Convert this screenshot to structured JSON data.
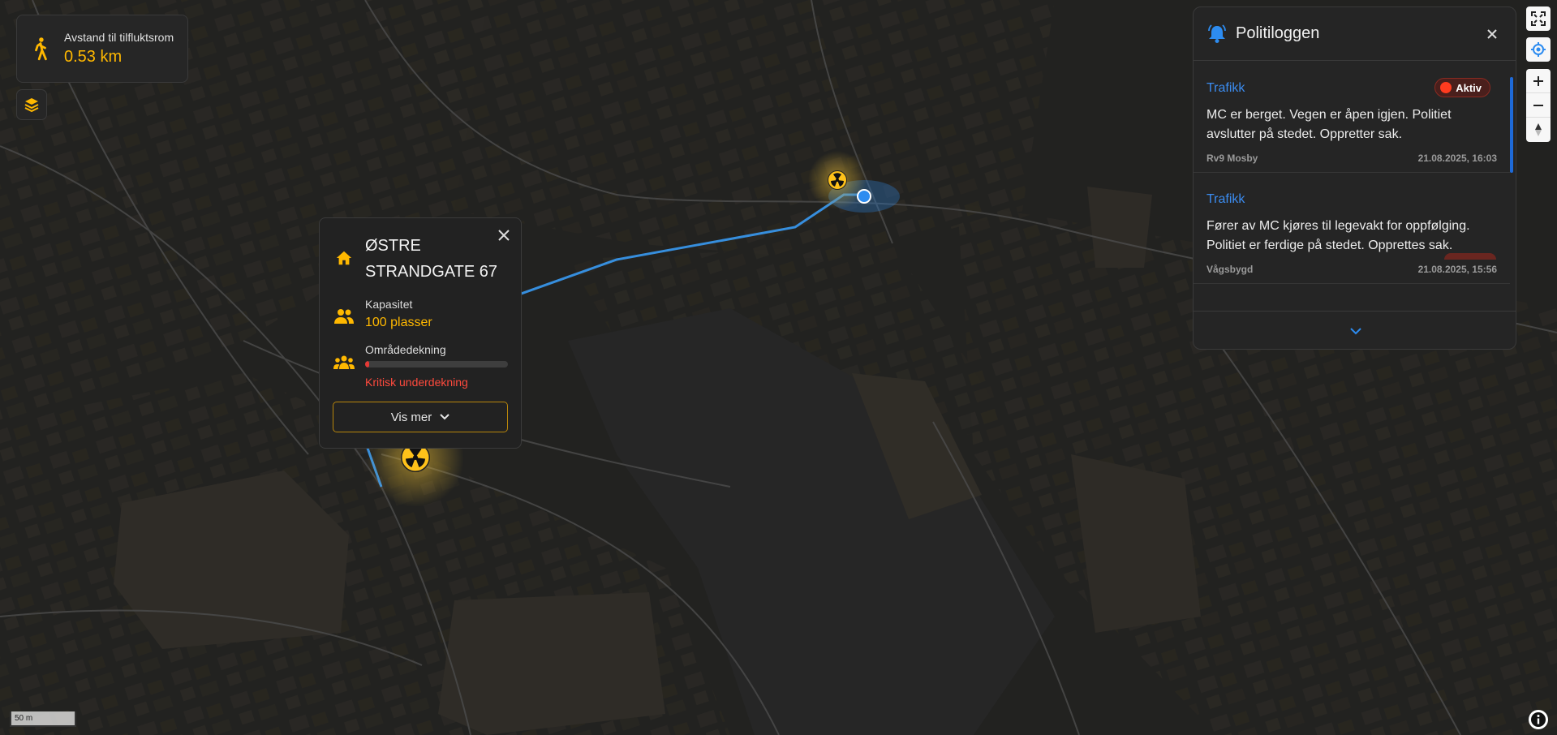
{
  "distance_card": {
    "label": "Avstand til tilfluktsrom",
    "value": "0.53 km",
    "icon": "walking-icon"
  },
  "layers_button": {
    "icon": "layers-icon"
  },
  "shelter_popup": {
    "title": "ØSTRE STRANDGATE 67",
    "capacity_label": "Kapasitet",
    "capacity_value": "100 plasser",
    "coverage_label": "Områdedekning",
    "coverage_fill": 0.03,
    "coverage_status": "Kritisk underdekning",
    "button_label": "Vis mer",
    "colors": {
      "accent": "#ffb800",
      "critical": "#ff4a3d"
    }
  },
  "police_log": {
    "title": "Politiloggen",
    "items": [
      {
        "category": "Trafikk",
        "badge": "Aktiv",
        "text": "MC er berget. Vegen er åpen igjen. Politiet avslutter på stedet. Oppretter sak.",
        "location": "Rv9 Mosby",
        "timestamp": "21.08.2025, 16:03"
      },
      {
        "category": "Trafikk",
        "badge": "",
        "text": "Fører av MC kjøres til legevakt for oppfølging. Politiet er ferdige på stedet. Opprettes sak.",
        "location": "Vågsbygd",
        "timestamp": "21.08.2025, 15:56"
      }
    ],
    "colors": {
      "category": "#3b8cf0",
      "badge": "#ff3b1f"
    }
  },
  "map": {
    "scale_label": "50 m",
    "markers": [
      {
        "icon": "radiation-shelter-icon"
      },
      {
        "icon": "radiation-shelter-icon"
      },
      {
        "icon": "user-location-icon"
      }
    ]
  }
}
